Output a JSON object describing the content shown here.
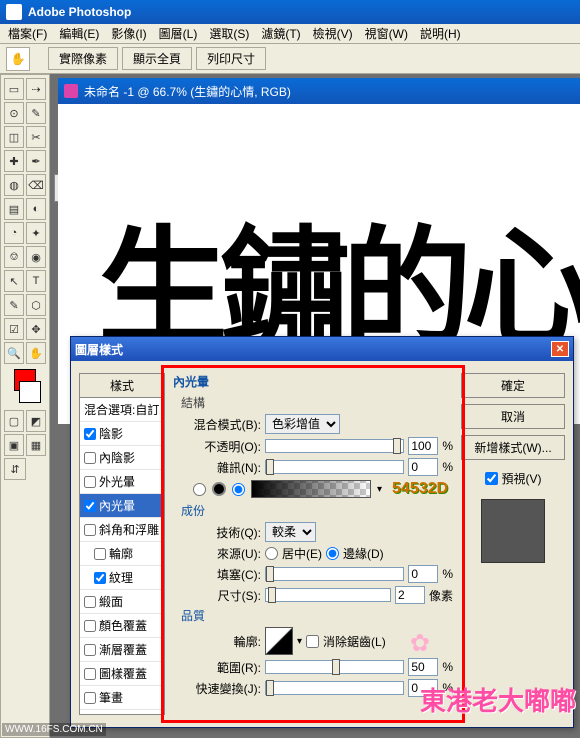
{
  "app": {
    "title": "Adobe Photoshop"
  },
  "menu": [
    "檔案(F)",
    "編輯(E)",
    "影像(I)",
    "圖層(L)",
    "選取(S)",
    "濾鏡(T)",
    "檢視(V)",
    "視窗(W)",
    "説明(H)"
  ],
  "optbar": {
    "hand": "✋",
    "btns": [
      "實際像素",
      "顯示全頁",
      "列印尺寸"
    ]
  },
  "tools": [
    [
      "▭",
      "⇢"
    ],
    [
      "⊙",
      "✎"
    ],
    [
      "◫",
      "✂"
    ],
    [
      "✚",
      "✒"
    ],
    [
      "◍",
      "⌫"
    ],
    [
      "▤",
      "◐"
    ],
    [
      "◔",
      "✦"
    ],
    [
      "⎊",
      "◉"
    ],
    [
      "↖",
      "T"
    ],
    [
      "✎",
      "⬡"
    ],
    [
      "☑",
      "✥"
    ],
    [
      "🔍",
      "✋"
    ]
  ],
  "doc": {
    "title": "未命名 -1 @ 66.7% (生鏽的心情, RGB)",
    "canvas_text": "生鏽的心情"
  },
  "dialog": {
    "title": "圖層樣式",
    "styles_hdr": "樣式",
    "blend_opt": "混合選項:自訂",
    "list": [
      {
        "label": "陰影",
        "chk": true
      },
      {
        "label": "內陰影",
        "chk": false
      },
      {
        "label": "外光暈",
        "chk": false
      },
      {
        "label": "內光暈",
        "chk": true,
        "selected": true
      },
      {
        "label": "斜角和浮雕",
        "chk": false
      },
      {
        "label": "輪廓",
        "chk": false
      },
      {
        "label": "紋理",
        "chk": true
      },
      {
        "label": "緞面",
        "chk": false
      },
      {
        "label": "顏色覆蓋",
        "chk": false
      },
      {
        "label": "漸層覆蓋",
        "chk": false
      },
      {
        "label": "圖樣覆蓋",
        "chk": false
      },
      {
        "label": "筆畫",
        "chk": false
      }
    ],
    "panel": {
      "title": "內光暈",
      "structure": "結構",
      "blend_label": "混合模式(B):",
      "blend_val": "色彩增值",
      "opacity_label": "不透明(O):",
      "opacity_val": "100",
      "pct": "%",
      "noise_label": "雜訊(N):",
      "noise_val": "0",
      "color_hex": "54532D",
      "elements": "成份",
      "tech_label": "技術(Q):",
      "tech_val": "較柔",
      "source_label": "來源(U):",
      "src_center": "居中(E)",
      "src_edge": "邊緣(D)",
      "choke_label": "填塞(C):",
      "choke_val": "0",
      "size_label": "尺寸(S):",
      "size_val": "2",
      "px": "像素",
      "quality": "品質",
      "contour_label": "輪廓:",
      "anti_label": "消除鋸齒(L)",
      "range_label": "範圍(R):",
      "range_val": "50",
      "jitter_label": "快速變換(J):",
      "jitter_val": "0"
    },
    "buttons": {
      "ok": "確定",
      "cancel": "取消",
      "new": "新增樣式(W)...",
      "preview": "預視(V)"
    }
  },
  "watermark": "東港老大嘟嘟",
  "footer": "WWW.16FS.COM.CN"
}
